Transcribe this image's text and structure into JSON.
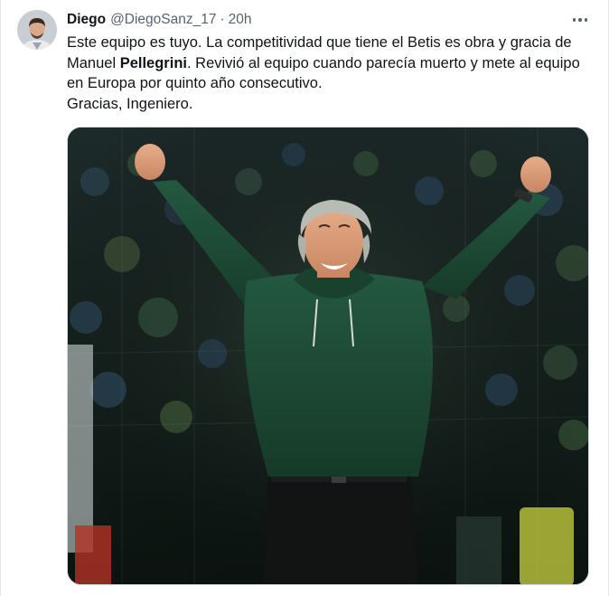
{
  "tweet": {
    "display_name": "Diego",
    "handle": "@DiegoSanz_17",
    "separator": "·",
    "time": "20h",
    "text": {
      "line1_part1": "Este equipo es tuyo. La competitividad que tiene el Betis es obra y gracia de Manuel ",
      "bold_name": "Pellegrini",
      "line1_part2": ". Revivió al equipo cuando parecía muerto y mete al equipo en Europa por quinto año consecutivo.",
      "line2": "Gracias, Ingeniero."
    }
  },
  "icons": {
    "more": "more-horizontal-icon"
  },
  "colors": {
    "text_primary": "#0f1419",
    "text_secondary": "#536471",
    "border": "#cfd9de",
    "sweater_green": "#1e4a33"
  }
}
